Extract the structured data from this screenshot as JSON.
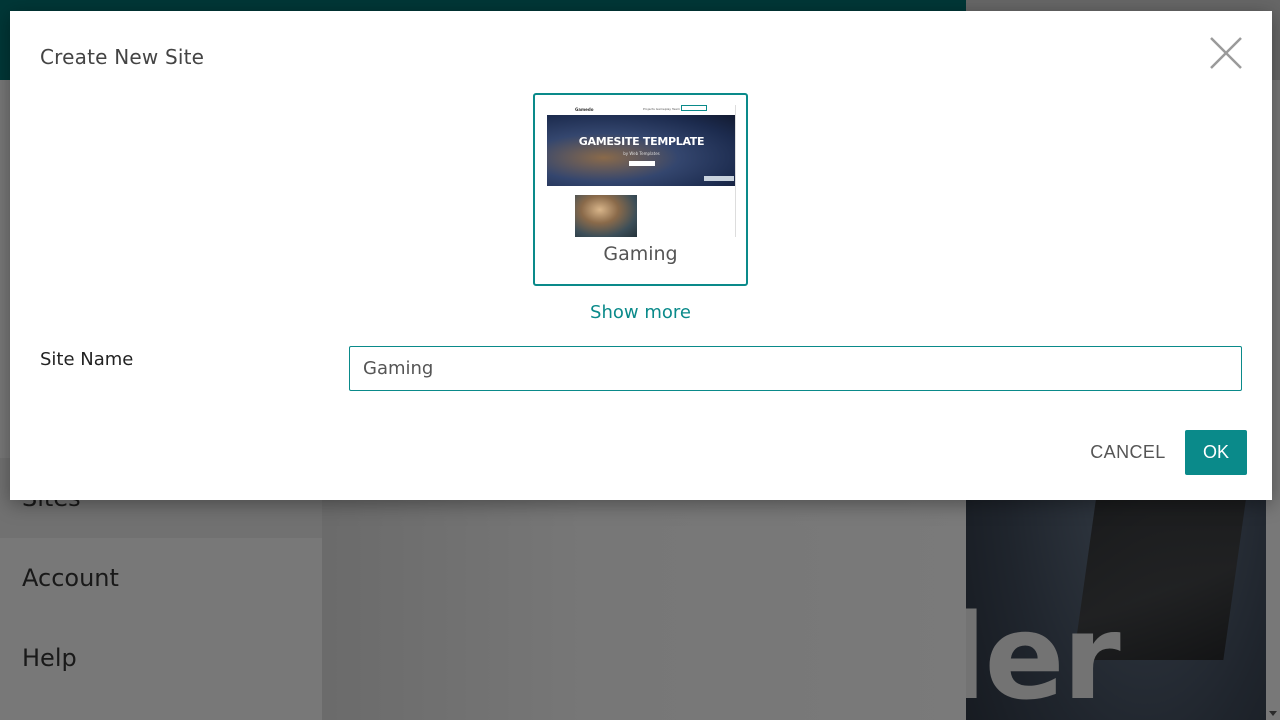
{
  "background": {
    "sidebar_items": [
      {
        "label": "Sites"
      },
      {
        "label": "Account"
      },
      {
        "label": "Help"
      }
    ],
    "hero_text": "ler"
  },
  "dialog": {
    "title": "Create New Site",
    "close_icon": "close-icon",
    "template": {
      "label": "Gaming",
      "thumbnail": {
        "logo": "Gamedo",
        "nav_links": "Projects  Gameplay  Team",
        "hero_title": "GAMESITE TEMPLATE",
        "hero_subtitle": "by Web Templates"
      }
    },
    "show_more_label": "Show more",
    "site_name": {
      "label": "Site Name",
      "value": "Gaming"
    },
    "cancel_label": "CANCEL",
    "ok_label": "OK"
  },
  "colors": {
    "accent": "#0a8a8a",
    "topbar": "#006e6e",
    "overlay": "rgba(0,0,0,0.5)"
  }
}
